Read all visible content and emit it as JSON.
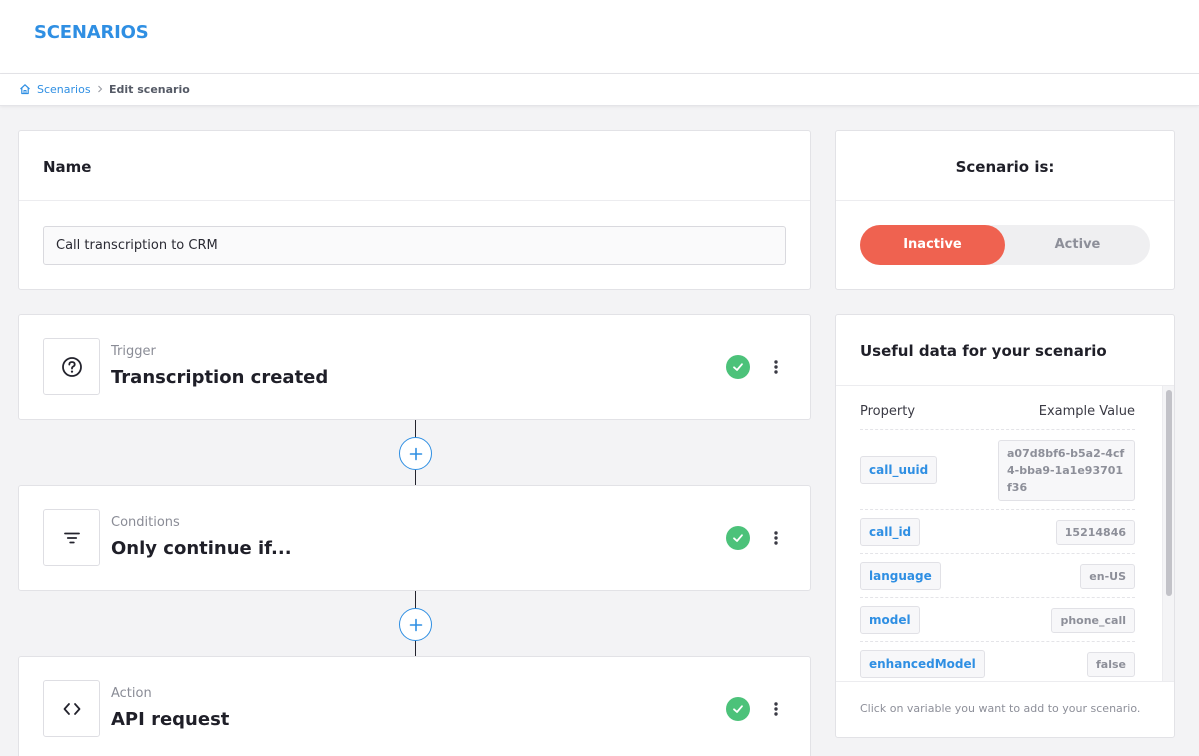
{
  "app": {
    "logo": "SCENARIOS"
  },
  "breadcrumb": {
    "home_icon": "home-icon",
    "link": "Scenarios",
    "current": "Edit scenario"
  },
  "name_card": {
    "title": "Name",
    "value": "Call transcription to CRM"
  },
  "status_card": {
    "title": "Scenario is:",
    "inactive_label": "Inactive",
    "active_label": "Active",
    "selected": "Inactive",
    "accent": "#ef6250"
  },
  "steps": [
    {
      "label": "Trigger",
      "title": "Transcription created",
      "icon": "question-circle-icon",
      "status": "complete"
    },
    {
      "label": "Conditions",
      "title": "Only continue if...",
      "icon": "filter-icon",
      "status": "complete"
    },
    {
      "label": "Action",
      "title": "API request",
      "icon": "code-icon",
      "status": "complete"
    }
  ],
  "useful_data": {
    "title": "Useful data for your scenario",
    "col_property": "Property",
    "col_example": "Example Value",
    "rows": [
      {
        "name": "call_uuid",
        "value": "a07d8bf6-b5a2-4cf4-bba9-1a1e93701f36"
      },
      {
        "name": "call_id",
        "value": "15214846"
      },
      {
        "name": "language",
        "value": "en-US"
      },
      {
        "name": "model",
        "value": "phone_call"
      },
      {
        "name": "enhancedModel",
        "value": "false"
      }
    ],
    "footer": "Click on variable you want to add to your scenario."
  },
  "colors": {
    "brand_blue": "#2f8fe3",
    "success_green": "#4cc27a",
    "inactive_red": "#ef6250"
  }
}
